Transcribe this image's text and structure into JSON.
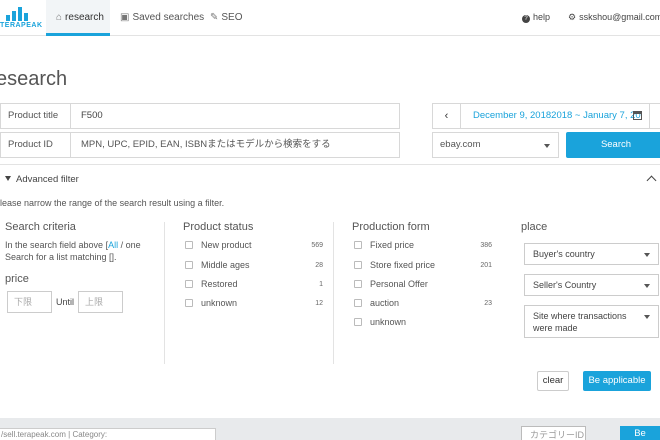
{
  "app": {
    "logo_text": "TERAPEAK",
    "brand_color": "#1aa3db"
  },
  "nav": {
    "research": "research",
    "saved_searches": "Saved searches",
    "seo": "SEO",
    "help": "help",
    "account": "sskshou@gmail.com"
  },
  "page": {
    "title": "esearch"
  },
  "search": {
    "product_title_label": "Product title",
    "product_title_value": "F500",
    "product_id_label": "Product ID",
    "product_id_placeholder": "MPN, UPC, EPID, EAN, ISBNまたはモデルから検索をする",
    "date_range": "December 9, 20182018 ~ January 7, 20",
    "site": "ebay.com",
    "search_button": "Search"
  },
  "filter": {
    "toggle_label": "Advanced filter",
    "hint": "lease narrow the range of the search result using a filter.",
    "criteria": {
      "title": "Search criteria",
      "text_1": "In the search field above [",
      "link_all": "All",
      "text_2": " / one Search for a list matching [].",
      "price_title": "price",
      "price_min_placeholder": "下限",
      "until": "Until",
      "price_max_placeholder": "上限"
    },
    "product_status": {
      "title": "Product status",
      "items": [
        {
          "label": "New product",
          "count": "569"
        },
        {
          "label": "Middle ages",
          "count": "28"
        },
        {
          "label": "Restored",
          "count": "1"
        },
        {
          "label": "unknown",
          "count": "12"
        }
      ]
    },
    "production_form": {
      "title": "Production form",
      "items": [
        {
          "label": "Fixed price",
          "count": "386"
        },
        {
          "label": "Store fixed price",
          "count": "201"
        },
        {
          "label": "Personal Offer",
          "count": ""
        },
        {
          "label": "auction",
          "count": "23"
        },
        {
          "label": "unknown",
          "count": ""
        }
      ]
    },
    "place": {
      "title": "place",
      "buyers_country": "Buyer's country",
      "sellers_country": "Seller's Country",
      "site_where": "Site where transactions were made"
    },
    "clear_button": "clear",
    "apply_button": "Be applicable"
  },
  "footer": {
    "url_text": "/sell.terapeak.com | Category:",
    "category_placeholder": "カテゴリーID",
    "button": "Be"
  }
}
